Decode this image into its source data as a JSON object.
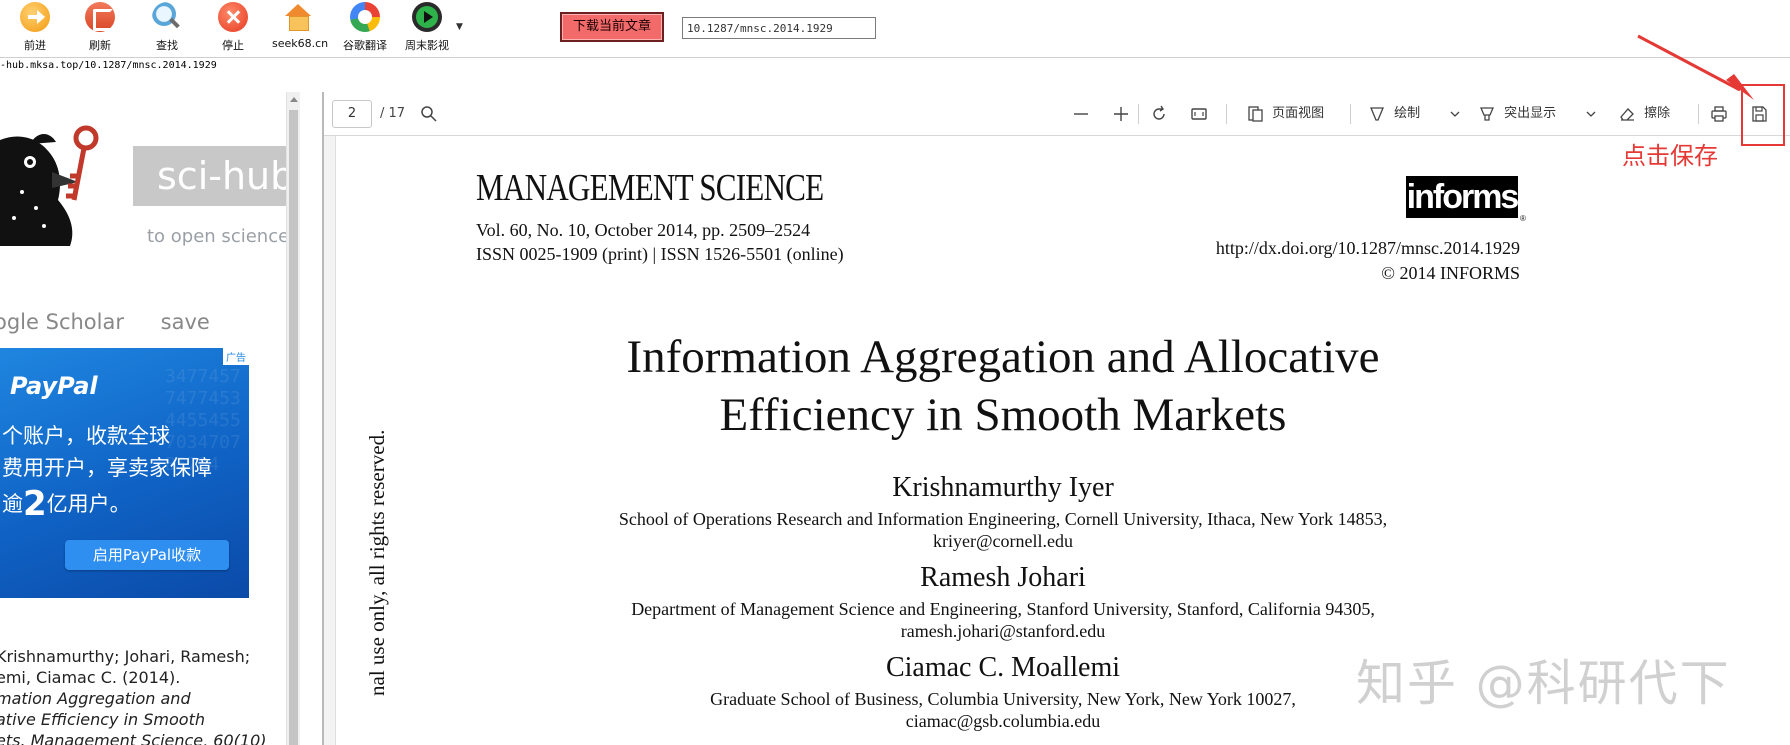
{
  "toolbar": {
    "buttons": [
      {
        "label": "前进",
        "icon": "forward-icon"
      },
      {
        "label": "刷新",
        "icon": "refresh-icon"
      },
      {
        "label": "查找",
        "icon": "search-icon"
      },
      {
        "label": "停止",
        "icon": "stop-icon"
      },
      {
        "label": "seek68.cn",
        "icon": "home-icon"
      },
      {
        "label": "谷歌翻译",
        "icon": "google-icon"
      },
      {
        "label": "周末影视",
        "icon": "video-icon"
      }
    ],
    "download_label": "下载当前文章",
    "doi_value": "10.1287/mnsc.2014.1929"
  },
  "url": "-hub.mksa.top/10.1287/mnsc.2014.1929",
  "scihub": {
    "logo_text": "sci-hub",
    "tagline": "to open science",
    "links": [
      "ogle Scholar",
      "save"
    ],
    "citation": {
      "line1": "Krishnamurthy; Johari, Ramesh;",
      "line2": "emi, Ciamac C. (2014).",
      "line3": "mation Aggregation and",
      "line4": "ative Efficiency in Smooth",
      "line5": "ets. Management Science, 60(10)"
    }
  },
  "ad": {
    "tag": "广告",
    "brand": "PayPal",
    "line1": "个账户，收款全球",
    "line2": "费用开户，享卖家保障",
    "line3_pre": "逾",
    "line3_num": "2",
    "line3_post": "亿用户。",
    "cta": "启用PayPal收款"
  },
  "pdf_toolbar": {
    "page_current": "2",
    "page_total": "/ 17",
    "page_view_label": "页面视图",
    "draw_label": "绘制",
    "highlight_label": "突出显示",
    "erase_label": "擦除"
  },
  "page": {
    "journal": "MANAGEMENT SCIENCE",
    "volume": "Vol. 60, No. 10, October 2014, pp. 2509–2524",
    "issn": "ISSN 0025-1909 (print) | ISSN 1526-5501 (online)",
    "publisher_logo": "informs",
    "publisher_mark": "®",
    "doi_url": "http://dx.doi.org/10.1287/mnsc.2014.1929",
    "copyright": "© 2014 INFORMS",
    "title_line1": "Information Aggregation and Allocative",
    "title_line2": "Efficiency in Smooth Markets",
    "authors": [
      {
        "name": "Krishnamurthy Iyer",
        "affil1": "School of Operations Research and Information Engineering, Cornell University, Ithaca, New York 14853,",
        "affil2": "kriyer@cornell.edu"
      },
      {
        "name": "Ramesh Johari",
        "affil1": "Department of Management Science and Engineering, Stanford University, Stanford, California 94305,",
        "affil2": "ramesh.johari@stanford.edu"
      },
      {
        "name": "Ciamac C. Moallemi",
        "affil1": "Graduate School of Business, Columbia University, New York, New York 10027,",
        "affil2": "ciamac@gsb.columbia.edu"
      }
    ],
    "vertical_note": "nal use only, all rights reserved."
  },
  "annotation": {
    "text": "点击保存",
    "color": "#e53935"
  },
  "watermark": "知乎 @科研代下"
}
